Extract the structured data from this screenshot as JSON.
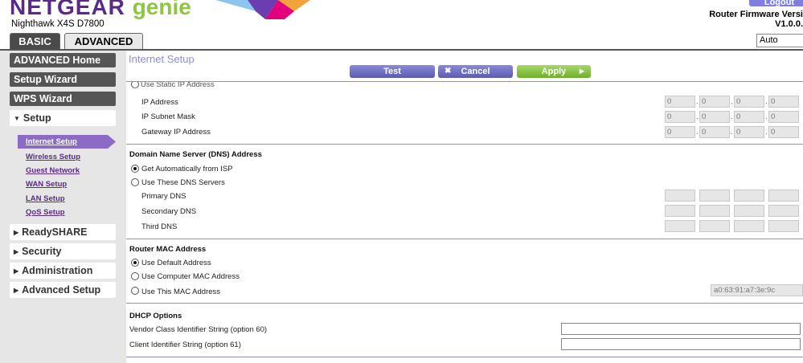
{
  "header": {
    "brand_main": "NETGEAR",
    "brand_sub": "genie",
    "model": "Nighthawk X4S D7800",
    "logout_label": "Logout",
    "firmware_label": "Router Firmware Versi",
    "firmware_version": "V1.0.0.",
    "tabs": [
      {
        "label": "BASIC"
      },
      {
        "label": "ADVANCED"
      }
    ],
    "language": "Auto"
  },
  "sidebar": {
    "advanced_home": "ADVANCED Home",
    "setup_wizard": "Setup Wizard",
    "wps_wizard": "WPS Wizard",
    "setup": "Setup",
    "sub_items": [
      {
        "label": "Internet Setup"
      },
      {
        "label": "Wireless Setup"
      },
      {
        "label": "Guest Network"
      },
      {
        "label": "WAN Setup"
      },
      {
        "label": "LAN Setup"
      },
      {
        "label": "QoS Setup"
      }
    ],
    "readyshare": "ReadySHARE",
    "security": "Security",
    "administration": "Administration",
    "advanced_setup": "Advanced Setup"
  },
  "main": {
    "title": "Internet Setup",
    "buttons": {
      "test": "Test",
      "cancel": "Cancel",
      "apply": "Apply"
    },
    "static_ip": {
      "radio_label": "Use Static IP Address",
      "ip_label": "IP Address",
      "mask_label": "IP Subnet Mask",
      "gateway_label": "Gateway IP Address",
      "ip_values": [
        "0",
        "0",
        "0",
        "0"
      ],
      "mask_values": [
        "0",
        "0",
        "0",
        "0"
      ],
      "gateway_values": [
        "0",
        "0",
        "0",
        "0"
      ]
    },
    "dns": {
      "section_title": "Domain Name Server (DNS) Address",
      "auto_label": "Get Automatically from ISP",
      "manual_label": "Use These DNS Servers",
      "primary_label": "Primary DNS",
      "secondary_label": "Secondary DNS",
      "third_label": "Third DNS"
    },
    "mac": {
      "section_title": "Router MAC Address",
      "default_label": "Use Default Address",
      "computer_label": "Use Computer MAC Address",
      "this_label": "Use This MAC Address",
      "mac_value": "a0:63:91:a7:3e:9c"
    },
    "dhcp": {
      "section_title": "DHCP Options",
      "vendor_label": "Vendor Class Identifier String (option 60)",
      "client_label": "Client Identifier String (option 61)"
    }
  },
  "colors": {
    "brand_purple": "#5b2a86",
    "genie_green": "#8dc63f",
    "accent_lavender": "#8b8be6",
    "apply_green": "#6fae2c"
  }
}
